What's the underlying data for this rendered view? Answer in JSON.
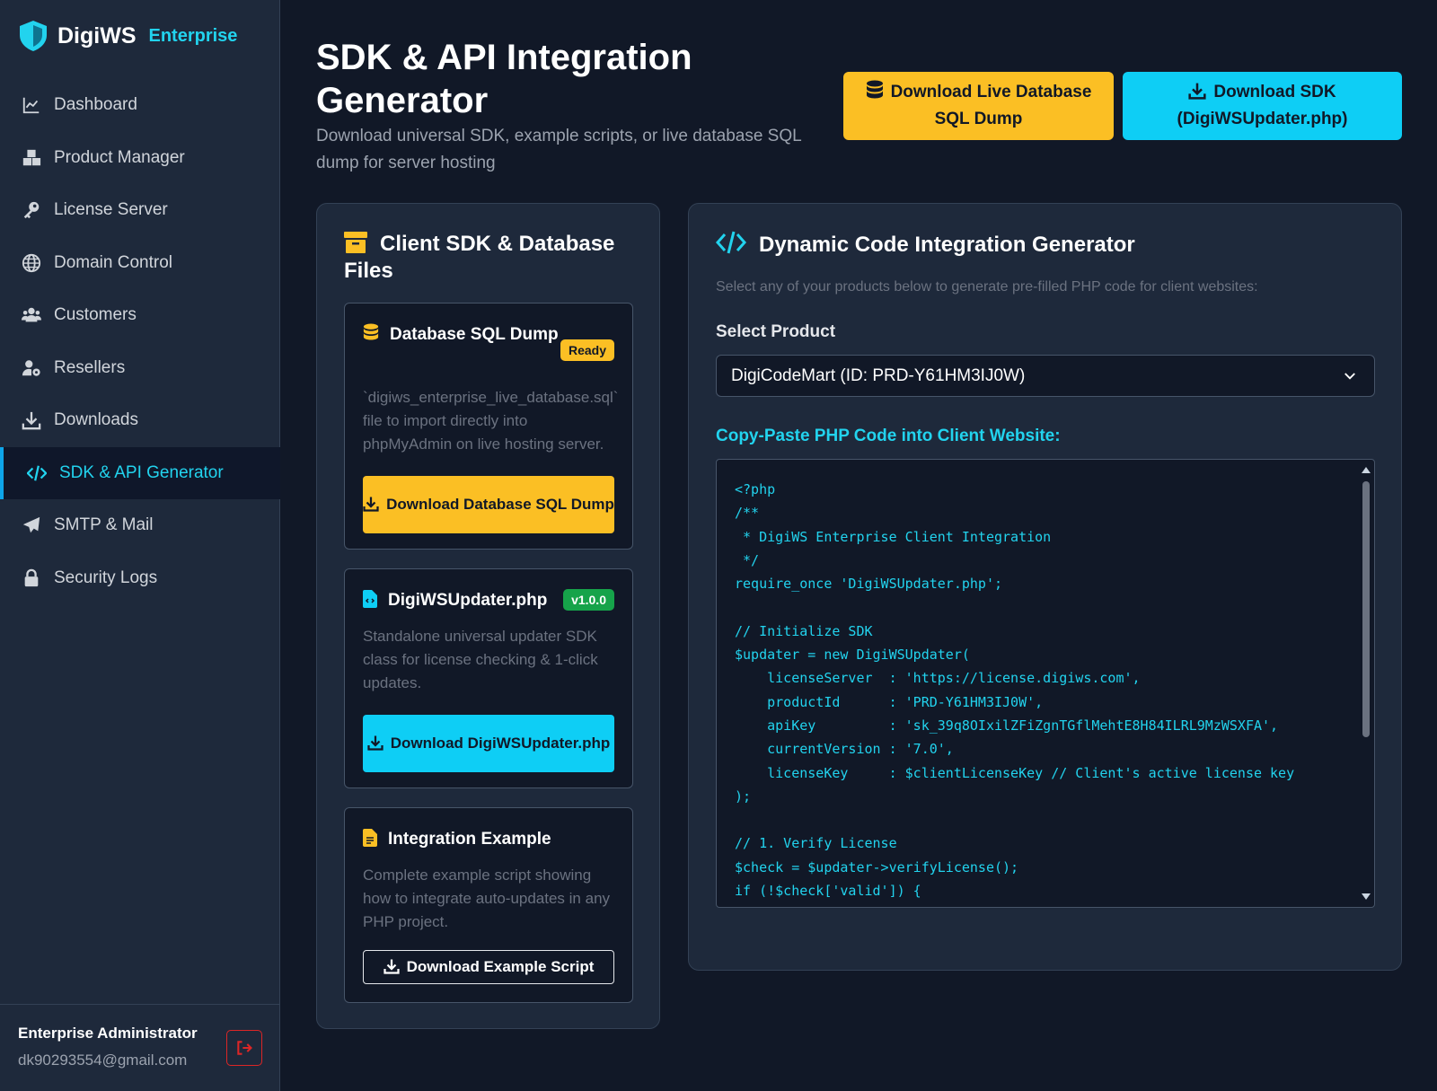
{
  "brand": {
    "name": "DigiWS",
    "edition": "Enterprise"
  },
  "nav": [
    {
      "label": "Dashboard",
      "icon": "chart-line-icon"
    },
    {
      "label": "Product Manager",
      "icon": "cubes-icon"
    },
    {
      "label": "License Server",
      "icon": "key-icon"
    },
    {
      "label": "Domain Control",
      "icon": "globe-icon"
    },
    {
      "label": "Customers",
      "icon": "users-icon"
    },
    {
      "label": "Resellers",
      "icon": "user-gear-icon"
    },
    {
      "label": "Downloads",
      "icon": "download-icon"
    },
    {
      "label": "SDK & API Generator",
      "icon": "code-icon",
      "active": true
    },
    {
      "label": "SMTP & Mail",
      "icon": "paper-plane-icon"
    },
    {
      "label": "Security Logs",
      "icon": "lock-icon"
    }
  ],
  "user": {
    "name": "Enterprise Administrator",
    "email": "dk90293554@gmail.com"
  },
  "header": {
    "title": "SDK & API Integration Generator",
    "subtitle": "Download universal SDK, example scripts, or live database SQL dump for server hosting",
    "btn_db": "Download Live Database SQL Dump",
    "btn_sdk": "Download SDK (DigiWSUpdater.php)"
  },
  "files_card": {
    "title": "Client SDK & Database Files",
    "db": {
      "title": "Database SQL Dump",
      "badge": "Ready",
      "desc": "`digiws_enterprise_live_database.sql` file to import directly into phpMyAdmin on live hosting server.",
      "button": "Download Database SQL Dump"
    },
    "sdk": {
      "title": "DigiWSUpdater.php",
      "badge": "v1.0.0",
      "desc": "Standalone universal updater SDK class for license checking & 1-click updates.",
      "button": "Download DigiWSUpdater.php"
    },
    "example": {
      "title": "Integration Example",
      "desc": "Complete example script showing how to integrate auto-updates in any PHP project.",
      "button": "Download Example Script"
    }
  },
  "generator": {
    "title": "Dynamic Code Integration Generator",
    "desc": "Select any of your products below to generate pre-filled PHP code for client websites:",
    "select_label": "Select Product",
    "selected_product": "DigiCodeMart (ID: PRD-Y61HM3IJ0W)",
    "code_label": "Copy-Paste PHP Code into Client Website:",
    "code": "<?php\n/**\n * DigiWS Enterprise Client Integration\n */\nrequire_once 'DigiWSUpdater.php';\n\n// Initialize SDK\n$updater = new DigiWSUpdater(\n    licenseServer  : 'https://license.digiws.com',\n    productId      : 'PRD-Y61HM3IJ0W',\n    apiKey         : 'sk_39q8OIxilZFiZgnTGflMehtE8H84ILRL9MzWSXFA',\n    currentVersion : '7.0',\n    licenseKey     : $clientLicenseKey // Client's active license key\n);\n\n// 1. Verify License\n$check = $updater->verifyLicense();\nif (!$check['valid']) {"
  },
  "colors": {
    "accent": "#22d3ee",
    "warning": "#fbbf24",
    "success": "#16a34a",
    "danger": "#dc2626"
  }
}
